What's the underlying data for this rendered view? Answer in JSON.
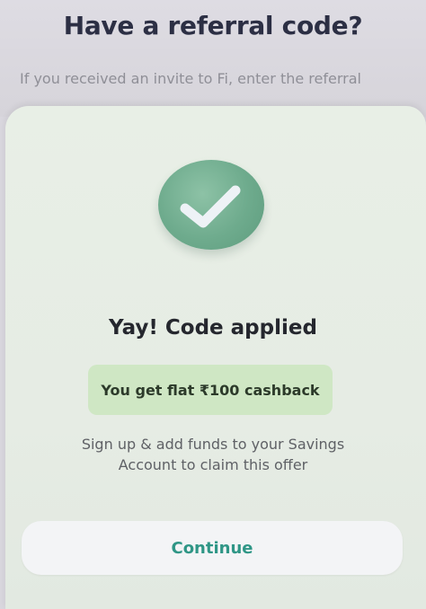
{
  "header": {
    "title": "Have a referral code?",
    "subtitle": "If you received an invite to Fi, enter the referral"
  },
  "sheet": {
    "status_icon": "check-icon",
    "title": "Yay! Code applied",
    "cashback_text": "You get flat ₹100 cashback",
    "description_line1": "Sign up & add funds to your Savings",
    "description_line2": "Account to claim this offer",
    "continue_label": "Continue"
  },
  "colors": {
    "accent_green": "#6eab8d",
    "pill_background": "#cfe7c4",
    "button_text": "#2f9686"
  }
}
